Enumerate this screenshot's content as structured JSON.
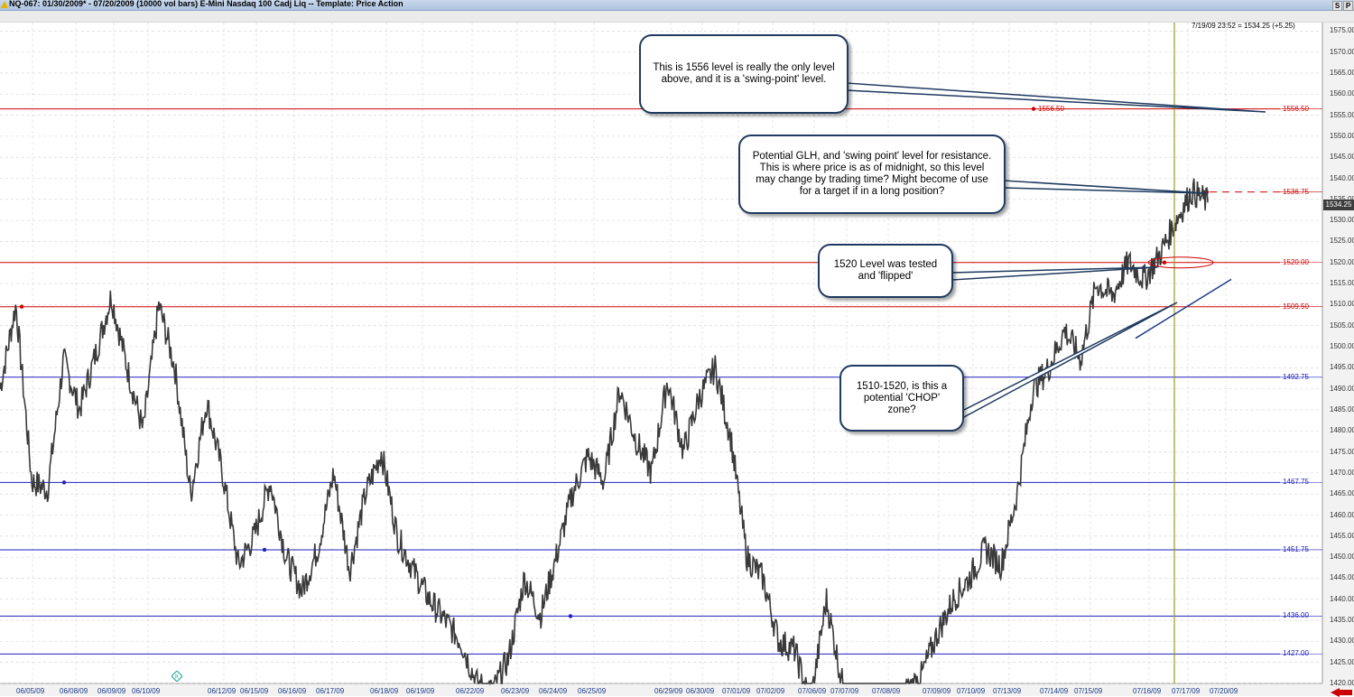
{
  "window": {
    "title": "NQ-067:  01/30/2009* - 07/20/2009  (10000 vol bars)   E-Mini Nasdaq 100 Cadj Liq  --  Template: Price Action",
    "buttons": [
      "S",
      "P"
    ]
  },
  "readout": "7/19/09 23:52 = 1534.25 (+5.25)",
  "current_price_tag": "1534.25",
  "callouts": {
    "c1556": "This is 1556 level is really the only level above, and it is a 'swing-point' level.",
    "cglh": "Potential GLH, and 'swing point' level for resistance. This is where price is as of midnight, so this level may change by trading time? Might become of use for a target if in a long position?",
    "c1520": "1520 Level was tested and 'flipped'",
    "cchop": "1510-1520, is this a potential 'CHOP' zone?"
  },
  "levels": [
    {
      "value": 1556.5,
      "label": "1556.50",
      "color": "#d00000",
      "style": "solid",
      "dot_label": "1556.50"
    },
    {
      "value": 1536.75,
      "label": "1536.75",
      "color": "#d00000",
      "style": "dashed"
    },
    {
      "value": 1520.0,
      "label": "1520.00",
      "color": "#d00000",
      "style": "solid"
    },
    {
      "value": 1509.5,
      "label": "1509.50",
      "color": "#d00000",
      "style": "solid"
    },
    {
      "value": 1492.75,
      "label": "1492.75",
      "color": "#2020c0",
      "style": "solid"
    },
    {
      "value": 1467.75,
      "label": "1467.75",
      "color": "#2020c0",
      "style": "solid"
    },
    {
      "value": 1451.75,
      "label": "1451.75",
      "color": "#2020c0",
      "style": "solid"
    },
    {
      "value": 1436.0,
      "label": "1436.00",
      "color": "#2020c0",
      "style": "solid"
    },
    {
      "value": 1427.0,
      "label": "1427.00",
      "color": "#2020c0",
      "style": "solid"
    }
  ],
  "chart_data": {
    "type": "line",
    "title": "E-Mini Nasdaq 100 Cadj Liq",
    "ylim": [
      1420,
      1577
    ],
    "yticks": [
      "1575.00",
      "1570.00",
      "1565.00",
      "1560.00",
      "1555.00",
      "1550.00",
      "1545.00",
      "1540.00",
      "1535.00",
      "1530.00",
      "1525.00",
      "1520.00",
      "1515.00",
      "1510.00",
      "1505.00",
      "1500.00",
      "1495.00",
      "1490.00",
      "1485.00",
      "1480.00",
      "1475.00",
      "1470.00",
      "1465.00",
      "1460.00",
      "1455.00",
      "1450.00",
      "1445.00",
      "1440.00",
      "1435.00",
      "1430.00",
      "1425.00",
      "1420.00"
    ],
    "xticks": [
      "06/05/09",
      "06/08/09",
      "06/09/09",
      "06/10/09",
      "06/12/09",
      "06/15/09",
      "06/16/09",
      "06/17/09",
      "06/18/09",
      "06/19/09",
      "06/22/09",
      "06/23/09",
      "06/24/09",
      "06/25/09",
      "06/29/09",
      "06/30/09",
      "07/01/09",
      "07/02/09",
      "07/06/09",
      "07/07/09",
      "07/08/09",
      "07/09/09",
      "07/10/09",
      "07/13/09",
      "07/14/09",
      "07/15/09",
      "07/16/09",
      "07/17/09",
      "07/20/09"
    ],
    "price_path": [
      1490,
      1510,
      1468,
      1466,
      1497,
      1485,
      1498,
      1512,
      1495,
      1480,
      1510,
      1495,
      1465,
      1487,
      1470,
      1448,
      1455,
      1468,
      1450,
      1442,
      1452,
      1470,
      1447,
      1465,
      1475,
      1455,
      1447,
      1440,
      1435,
      1430,
      1420,
      1418,
      1426,
      1445,
      1436,
      1450,
      1465,
      1474,
      1468,
      1490,
      1478,
      1470,
      1492,
      1475,
      1488,
      1495,
      1478,
      1450,
      1445,
      1430,
      1428,
      1415,
      1440,
      1420,
      1410,
      1405,
      1412,
      1418,
      1422,
      1432,
      1440,
      1445,
      1452,
      1448,
      1465,
      1490,
      1495,
      1504,
      1497,
      1515,
      1512,
      1520,
      1516,
      1522,
      1530,
      1537,
      1534.25
    ],
    "current_price": 1534.25,
    "grid": true,
    "legend": "none"
  }
}
